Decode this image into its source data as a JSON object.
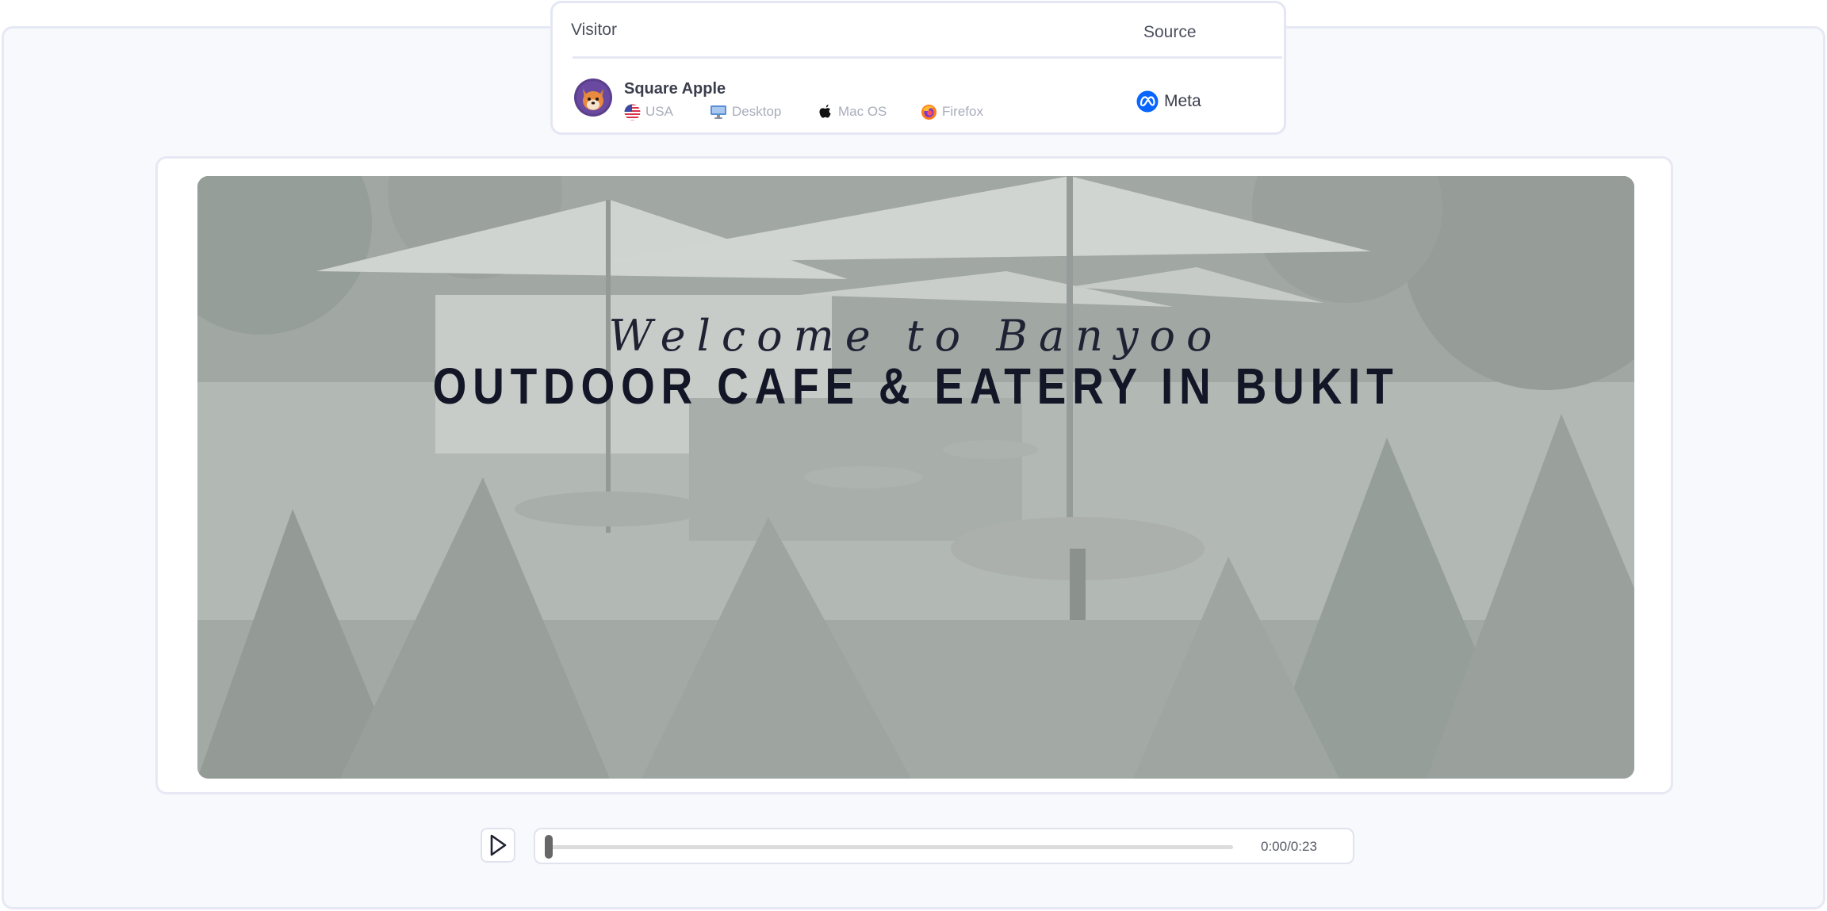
{
  "visitor_table": {
    "columns": {
      "visitor": "Visitor",
      "source": "Source"
    },
    "row": {
      "name": "Square Apple",
      "avatar_icon": "fox-avatar",
      "country": "USA",
      "country_icon": "us-flag-icon",
      "device": "Desktop",
      "device_icon": "desktop-icon",
      "os": "Mac OS",
      "os_icon": "apple-icon",
      "browser": "Firefox",
      "browser_icon": "firefox-icon",
      "source": "Meta",
      "source_icon": "meta-icon"
    }
  },
  "video": {
    "welcome_text": "Welcome to Banyoo",
    "headline": "OUTDOOR CAFE & EATERY IN BUKIT"
  },
  "player": {
    "play_icon": "play-icon",
    "time": "0:00/0:23",
    "progress_fraction": 0.0
  },
  "colors": {
    "meta_blue": "#0866ff",
    "avatar_bg": "#5b3f8c",
    "headline": "#121626"
  }
}
